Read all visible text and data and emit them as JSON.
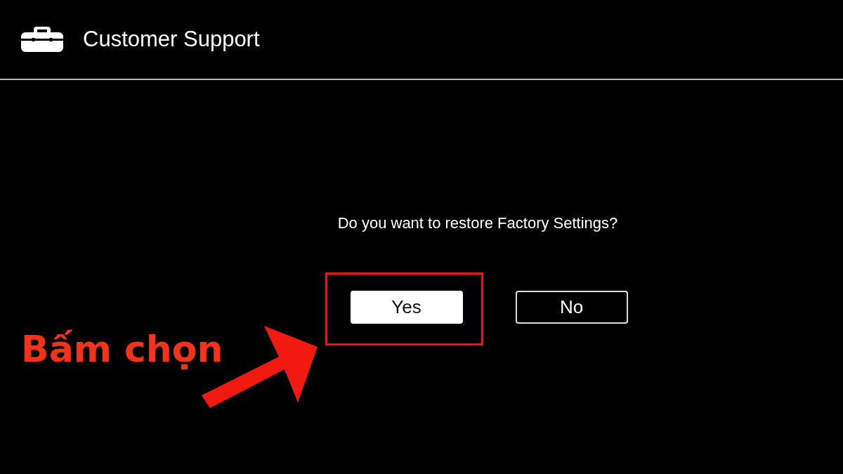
{
  "header": {
    "title": "Customer Support"
  },
  "dialog": {
    "question": "Do you want to restore Factory Settings?",
    "buttons": [
      {
        "label": "Yes",
        "selected": true
      },
      {
        "label": "No",
        "selected": false
      }
    ]
  },
  "annotation": {
    "label": "Bấm chọn"
  }
}
